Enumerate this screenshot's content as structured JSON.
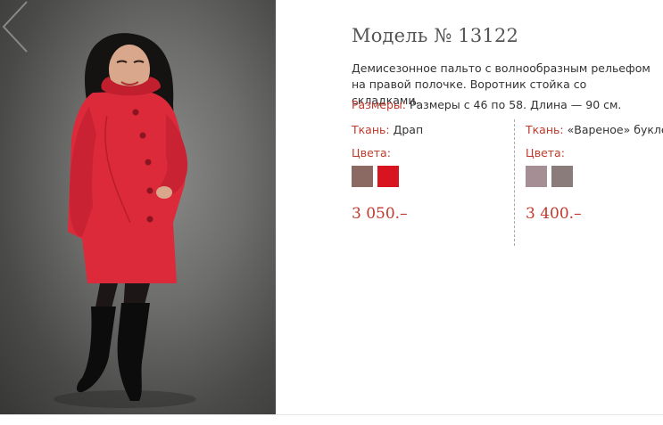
{
  "product": {
    "title": "Модель № 13122",
    "description": "Демисезонное пальто с волнообразным рельефом на правой полочке. Воротник стойка со складками.",
    "sizes_label": "Размеры:",
    "sizes_value": "Размеры с 46 по 58. Длина — 90 см."
  },
  "photo": {
    "alt": "Woman in red coat",
    "prev_icon": "chevron-left-icon"
  },
  "variants": [
    {
      "fabric_label": "Ткань:",
      "fabric_value": "Драп",
      "colors_label": "Цвета:",
      "swatches": [
        "#8a6a62",
        "#d7141f"
      ],
      "price": "3 050.–"
    },
    {
      "fabric_label": "Ткань:",
      "fabric_value": "«Вареное» букле",
      "colors_label": "Цвета:",
      "swatches": [
        "#a58f95",
        "#8b7c7c"
      ],
      "price": "3 400.–"
    }
  ],
  "colors": {
    "accent": "#c0392b",
    "coat": "#dd2a3a"
  }
}
